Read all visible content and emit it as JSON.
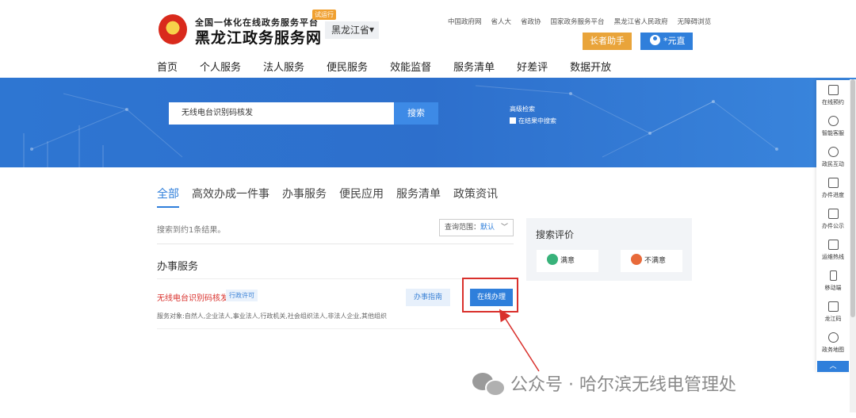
{
  "header": {
    "logo_sub": "全国一体化在线政务服务平台",
    "logo_main": "黑龙江政务服务网",
    "trial_badge": "试运行",
    "province": "黑龙江省",
    "top_links": [
      "中国政府网",
      "省人大",
      "省政协",
      "国家政务服务平台",
      "黑龙江省人民政府",
      "无障碍浏览"
    ],
    "elder_button": "长者助手",
    "user_button": "*元直"
  },
  "main_nav": [
    "首页",
    "个人服务",
    "法人服务",
    "便民服务",
    "效能监督",
    "服务清单",
    "好差评",
    "数据开放"
  ],
  "search": {
    "value": "无线电台识别码核发",
    "button": "搜索",
    "advanced": "高级检索",
    "within_results": "在结果中搜索"
  },
  "tabs": [
    "全部",
    "高效办成一件事",
    "办事服务",
    "便民应用",
    "服务清单",
    "政策资讯"
  ],
  "results": {
    "count_text": "搜索到约1条结果。",
    "scope_label": "查询范围：",
    "scope_value": "默认",
    "section_title": "办事服务",
    "item": {
      "title": "无线电台识别码核发",
      "tag": "行政许可",
      "guide_button": "办事指南",
      "online_button": "在线办理",
      "description": "服务对象:自然人,企业法人,事业法人,行政机关,社会组织法人,非法人企业,其他组织"
    }
  },
  "evaluation": {
    "title": "搜索评价",
    "good": "满意",
    "bad": "不满意"
  },
  "sidebar": [
    {
      "label": "在线预约",
      "icon": "calendar-icon"
    },
    {
      "label": "智能客服",
      "icon": "headset-icon"
    },
    {
      "label": "政民互动",
      "icon": "chat-icon"
    },
    {
      "label": "办件进度",
      "icon": "search-doc-icon"
    },
    {
      "label": "办件公示",
      "icon": "briefcase-icon"
    },
    {
      "label": "运维热线",
      "icon": "edit-icon"
    },
    {
      "label": "移动端",
      "icon": "mobile-icon"
    },
    {
      "label": "龙江码",
      "icon": "qrcode-icon"
    },
    {
      "label": "政务地图",
      "icon": "map-pin-icon"
    }
  ],
  "back_to_top": "︿",
  "watermark": "公众号 · 哈尔滨无线电管理处",
  "colors": {
    "primary_blue": "#2f7fdb",
    "banner_blue": "#2e76d2",
    "elder_orange": "#e9a43a",
    "highlight_red": "#d9302c"
  }
}
